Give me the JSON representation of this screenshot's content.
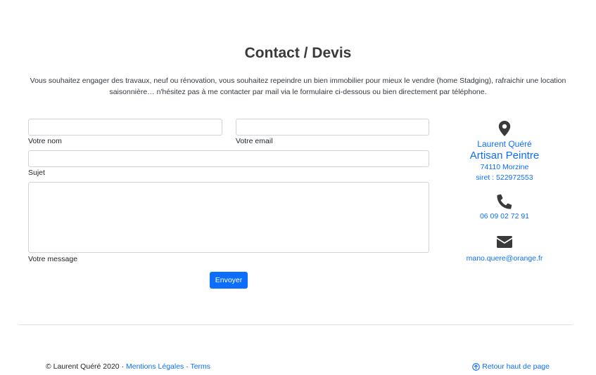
{
  "page": {
    "title": "Contact / Devis",
    "intro_line1": "Vous souhaitez engager des travaux, neuf ou rénovation, vous souhaitez repeindre un bien immobilier pour mieux le vendre (home Stadging), rafraichir une location",
    "intro_line2": "saisonnière… n'hésitez pas à me contacter par mail via le formulaire ci-dessous ou bien directement par téléphone."
  },
  "form": {
    "name_label": "Votre nom",
    "name_value": "",
    "email_label": "Votre email",
    "email_value": "",
    "subject_label": "Sujet",
    "subject_value": "",
    "message_label": "Votre message",
    "message_value": "",
    "submit_label": "Envoyer"
  },
  "contact": {
    "name": "Laurent Quéré",
    "role": "Artisan Peintre",
    "city": "74110 Morzine",
    "siret": "siret : 522972553",
    "phone": "06 09 02 72 91",
    "email": "mano.quere@orange.fr",
    "icons": [
      "map-marker-icon",
      "phone-icon",
      "envelope-icon"
    ],
    "icon_color": "#3a3a3a",
    "link_color": "#0d6efd"
  },
  "footer": {
    "copyright": "© Laurent Quéré 2020",
    "separator": " · ",
    "legal_link": "Mentions Légales",
    "terms_link": "Terms",
    "back_to_top": "Retour haut de page"
  },
  "colors": {
    "primary": "#0d6efd",
    "heading": "#3a3a3a",
    "border": "#ced4da"
  }
}
